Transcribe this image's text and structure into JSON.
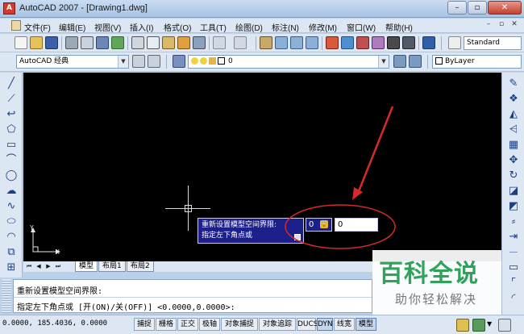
{
  "window": {
    "title": "AutoCAD 2007 - [Drawing1.dwg]",
    "app_icon_glyph": "A",
    "minimize": "–",
    "maximize": "▫",
    "close": "✕"
  },
  "menu": {
    "items": [
      "文件(F)",
      "编辑(E)",
      "视图(V)",
      "插入(I)",
      "格式(O)",
      "工具(T)",
      "绘图(D)",
      "标注(N)",
      "修改(M)",
      "窗口(W)",
      "帮助(H)"
    ],
    "doc_controls": [
      "–",
      "▫",
      "✕"
    ]
  },
  "toolbar": {
    "text_style": "Standard",
    "workspace": "AutoCAD 经典",
    "layer": "0",
    "color": "ByLayer"
  },
  "drawing": {
    "ucs_y": "Y",
    "ucs_x": "X",
    "tooltip_line1": "重新设置模型空间界限:",
    "tooltip_line2": "指定左下角点或",
    "dyn_value1": "0",
    "dyn_value2": "0",
    "annotation_color": "#d42a2a"
  },
  "layout_tabs": {
    "tabs": [
      "模型",
      "布局1",
      "布局2"
    ],
    "active": "模型"
  },
  "command": {
    "line1": "重新设置模型空间界限:",
    "line2": "指定左下角点或 [开(ON)/关(OFF)] <0.0000,0.0000>:"
  },
  "status": {
    "coords": "0.0000,  185.4036, 0.0000",
    "buttons": [
      "捕捉",
      "栅格",
      "正交",
      "极轴",
      "对象捕捉",
      "对象追踪",
      "DUCS",
      "DYN",
      "线宽",
      "模型"
    ]
  },
  "watermark": {
    "title": "百科全说",
    "subtitle": "助你轻松解决"
  },
  "colors": {
    "canvas": "#000000",
    "chrome": "#dde7f3",
    "tooltip_bg": "#1d1f8a",
    "watermark_green": "#2fa35a"
  }
}
